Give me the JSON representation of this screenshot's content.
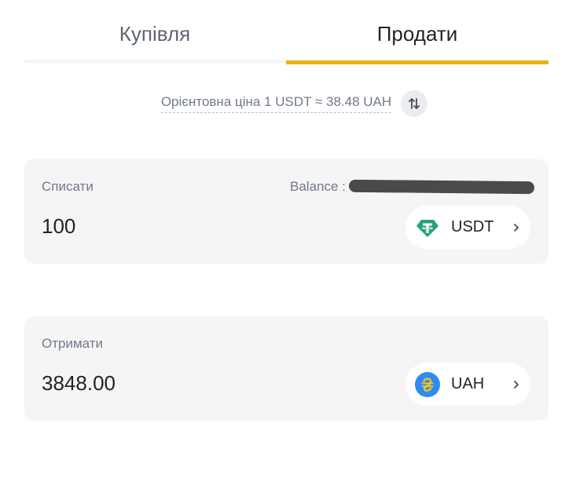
{
  "tabs": {
    "buy_label": "Купівля",
    "sell_label": "Продати",
    "active": "sell"
  },
  "price": {
    "text": "Орієнтовна ціна 1 USDT ≈ 38.48 UAH"
  },
  "from_card": {
    "label": "Списати",
    "balance_label": "Balance :",
    "amount": "100",
    "coin": "USDT",
    "coin_icon": "tether-icon"
  },
  "to_card": {
    "label": "Отримати",
    "amount": "3848.00",
    "coin": "UAH",
    "coin_icon": "hryvnia-icon"
  },
  "colors": {
    "accent": "#e8b50f",
    "tether": "#26a17b",
    "hryvnia_bg": "#2f8af5",
    "hryvnia_fg": "#f5c518"
  }
}
